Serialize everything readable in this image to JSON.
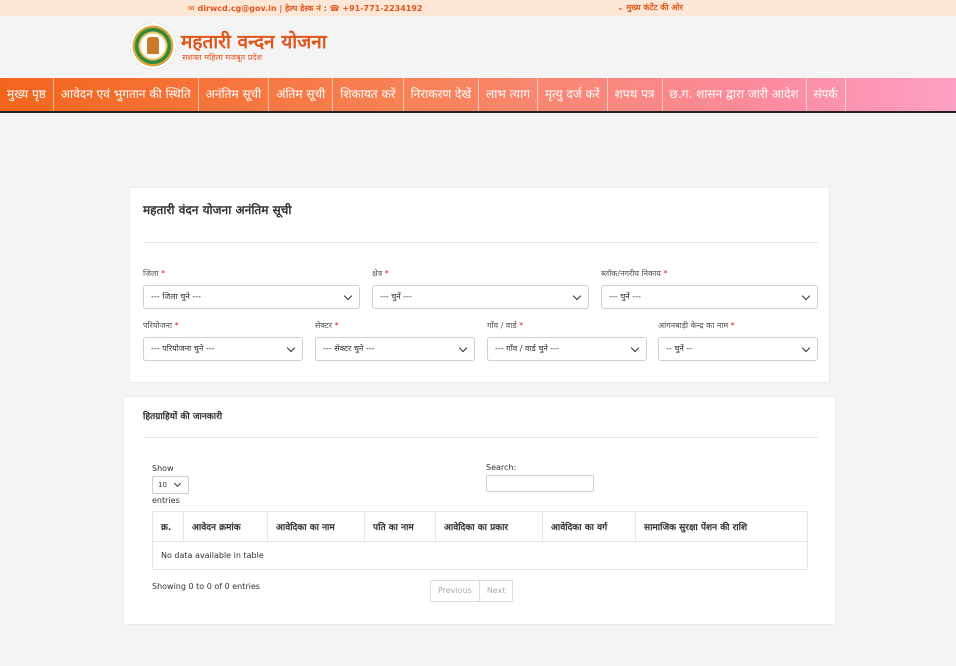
{
  "topbar": {
    "email_icon": "envelope-icon",
    "email": "dirwcd.cg@gov.in",
    "separator": " | ",
    "helpdesk_label": "हेल्प डेस्क नं : ",
    "phone_icon": "phone-icon",
    "phone": "+91-771-2234192",
    "skip_icon": "chevron-down-icon",
    "skip_link": "मुख्य कंटेंट की ओर"
  },
  "brand": {
    "title": "महतारी वन्दन योजना",
    "subtitle": "सशक्त महिला मजबूत प्रदेश"
  },
  "nav": {
    "items": [
      "मुख्य पृष्ठ",
      "आवेदन एवं भुगतान की स्थिति",
      "अनंतिम सूची",
      "अंतिम सूची",
      "शिकायत करें",
      "निराकरण देखें",
      "लाभ त्याग",
      "मृत्यु दर्ज करें",
      "शपथ पत्र",
      "छ.ग. शासन द्वारा जारी आदेश",
      "संपर्क"
    ]
  },
  "filters": {
    "title": "महतारी वंदन योजना अनंतिम सूची",
    "required_mark": "*",
    "district": {
      "label": "जिला",
      "value": "--- जिला चुने ---"
    },
    "area": {
      "label": "क्षेत्र",
      "value": "--- चुनें ---"
    },
    "block": {
      "label": "ब्लॉक/नगरीय निकाय",
      "value": "--- चुनें ---"
    },
    "project": {
      "label": "परियोजना",
      "value": "--- परियोजना चुने ---"
    },
    "sector": {
      "label": "सेक्टर",
      "value": "--- सेक्टर चुने ---"
    },
    "village": {
      "label": "गाँव / वार्ड",
      "value": "--- गाँव / वार्ड चुने ---"
    },
    "anganwadi": {
      "label": "आंगनबाड़ी केन्द्र का नाम",
      "value": "-- चुनें --"
    }
  },
  "beneficiaries": {
    "title": "हितग्राहियों की जानकारी",
    "show_label": "Show",
    "page_length": "10",
    "entries_label": "entries",
    "search_label": "Search:",
    "search_value": "",
    "columns": [
      "क्र.",
      "आवेदन क्रमांक",
      "आवेदिका का नाम",
      "पति का नाम",
      "आवेदिका का प्रकार",
      "आवेदिका का वर्ग",
      "सामाजिक सुरक्षा पेंशन की राशि"
    ],
    "empty_message": "No data available in table",
    "info": "Showing 0 to 0 of 0 entries",
    "prev_label": "Previous",
    "next_label": "Next"
  }
}
